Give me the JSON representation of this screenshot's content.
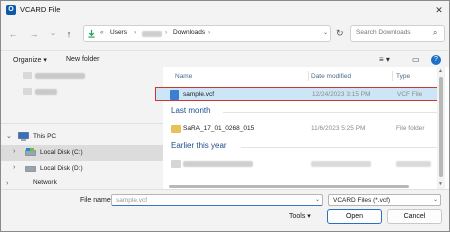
{
  "window": {
    "title": "VCARD File",
    "app_icon_letter": "O"
  },
  "nav": {
    "back": "←",
    "forward": "→",
    "recent": "⌄",
    "up": "↑",
    "breadcrumbs": [
      "«",
      "Users",
      "›",
      "›",
      "Downloads",
      "›"
    ],
    "search_placeholder": "Search Downloads"
  },
  "toolbar": {
    "organize": "Organize ▾",
    "new_folder": "New folder",
    "view_icon": "≡ ▾",
    "pane_icon": "▭",
    "help_icon": "?"
  },
  "sidebar": {
    "this_pc": "This PC",
    "local_c": "Local Disk (C:)",
    "local_d": "Local Disk (D:)",
    "network": "Network"
  },
  "columns": {
    "name": "Name",
    "date": "Date modified",
    "type": "Type"
  },
  "groups": {
    "last_month": "Last month",
    "earlier": "Earlier this year"
  },
  "files": [
    {
      "name": "sample.vcf",
      "date": "12/24/2023 3:15 PM",
      "type": "VCF File",
      "selected": true,
      "icon": "vcf-file-icon"
    },
    {
      "name": "SaRA_17_01_0268_015",
      "date": "11/6/2023 5:25 PM",
      "type": "File folder",
      "selected": false,
      "icon": "folder-icon"
    }
  ],
  "bottom": {
    "file_name_label": "File name:",
    "file_name_value": "sample.vcf",
    "file_type": "VCARD Files (*.vcf)",
    "tools": "Tools",
    "open": "Open",
    "cancel": "Cancel"
  },
  "colors": {
    "selection": "#cde6f7",
    "highlight_box": "#d0342c",
    "group_text": "#1f4e8c",
    "accent": "#2a6fc2"
  }
}
